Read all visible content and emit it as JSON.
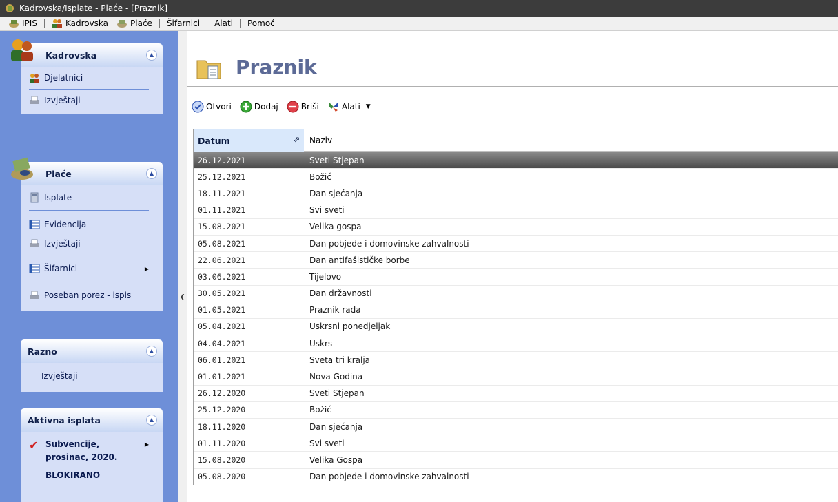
{
  "window": {
    "title": "Kadrovska/Isplate - Plaće - [Praznik]"
  },
  "menu": {
    "items": [
      {
        "label": "IPIS",
        "icon": "ipis-icon"
      },
      {
        "label": "Kadrovska",
        "icon": "people-icon"
      },
      {
        "label": "Plaće",
        "icon": "coins-icon"
      },
      {
        "label": "Šifarnici"
      },
      {
        "label": "Alati"
      },
      {
        "label": "Pomoć"
      }
    ]
  },
  "sidebar": {
    "kadrovska": {
      "title": "Kadrovska",
      "items": [
        "Djelatnici",
        "Izvještaji"
      ]
    },
    "place": {
      "title": "Plaće",
      "items": [
        "Isplate",
        "Evidencija",
        "Izvještaji",
        "Šifarnici",
        "Poseban porez - ispis"
      ]
    },
    "razno": {
      "title": "Razno",
      "items": [
        "Izvještaji"
      ]
    },
    "aktivna": {
      "title": "Aktivna isplata",
      "item_line1": "Subvencije,",
      "item_line2": "prosinac, 2020.",
      "status": "BLOKIRANO"
    }
  },
  "page": {
    "title": "Praznik"
  },
  "toolbar": {
    "open": "Otvori",
    "add": "Dodaj",
    "delete": "Briši",
    "tools": "Alati"
  },
  "grid": {
    "columns": {
      "date": "Datum",
      "name": "Naziv"
    },
    "rows": [
      {
        "date": "26.12.2021",
        "name": "Sveti Stjepan"
      },
      {
        "date": "25.12.2021",
        "name": "Božić"
      },
      {
        "date": "18.11.2021",
        "name": "Dan sjećanja"
      },
      {
        "date": "01.11.2021",
        "name": "Svi sveti"
      },
      {
        "date": "15.08.2021",
        "name": "Velika gospa"
      },
      {
        "date": "05.08.2021",
        "name": "Dan pobjede i domovinske zahvalnosti"
      },
      {
        "date": "22.06.2021",
        "name": "Dan antifašističke borbe"
      },
      {
        "date": "03.06.2021",
        "name": "Tijelovo"
      },
      {
        "date": "30.05.2021",
        "name": "Dan državnosti"
      },
      {
        "date": "01.05.2021",
        "name": "Praznik rada"
      },
      {
        "date": "05.04.2021",
        "name": "Uskrsni ponedjeljak"
      },
      {
        "date": "04.04.2021",
        "name": "Uskrs"
      },
      {
        "date": "06.01.2021",
        "name": "Sveta tri kralja"
      },
      {
        "date": "01.01.2021",
        "name": "Nova Godina"
      },
      {
        "date": "26.12.2020",
        "name": "Sveti Stjepan"
      },
      {
        "date": "25.12.2020",
        "name": "Božić"
      },
      {
        "date": "18.11.2020",
        "name": "Dan sjećanja"
      },
      {
        "date": "01.11.2020",
        "name": "Svi sveti"
      },
      {
        "date": "15.08.2020",
        "name": "Velika Gospa"
      },
      {
        "date": "05.08.2020",
        "name": "Dan pobjede i domovinske zahvalnosti"
      }
    ],
    "selected_index": 0
  }
}
